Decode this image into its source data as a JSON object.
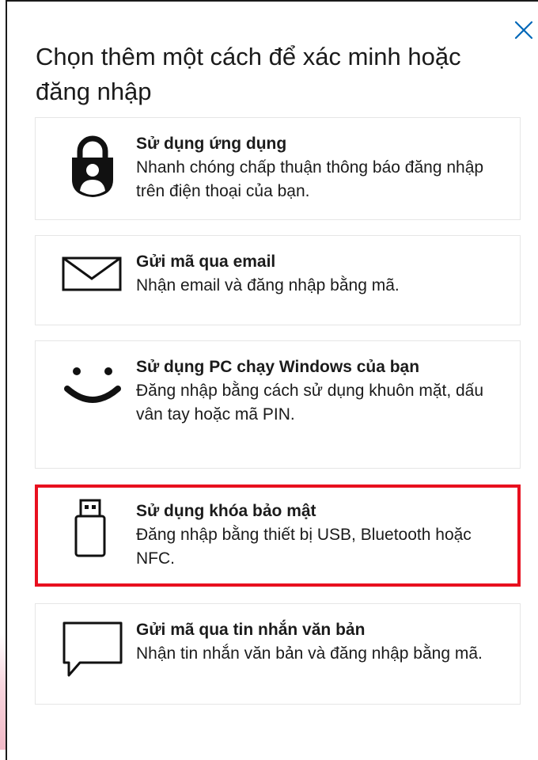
{
  "dialog": {
    "title": "Chọn thêm một cách để xác minh hoặc đăng nhập",
    "close_label": "×"
  },
  "options": [
    {
      "title": "Sử dụng ứng dụng",
      "description": "Nhanh chóng chấp thuận thông báo đăng nhập trên điện thoại của bạn.",
      "icon": "authenticator-lock-icon"
    },
    {
      "title": "Gửi mã qua email",
      "description": "Nhận email và đăng nhập bằng mã.",
      "icon": "email-envelope-icon"
    },
    {
      "title": "Sử dụng PC chạy Windows của bạn",
      "description": "Đăng nhập bằng cách sử dụng khuôn mặt, dấu vân tay hoặc mã PIN.",
      "icon": "windows-hello-face-icon"
    },
    {
      "title": "Sử dụng khóa bảo mật",
      "description": "Đăng nhập bằng thiết bị USB, Bluetooth hoặc NFC.",
      "icon": "usb-security-key-icon",
      "highlighted": true
    },
    {
      "title": "Gửi mã qua tin nhắn văn bản",
      "description": "Nhận tin nhắn văn bản và đăng nhập bằng mã.",
      "icon": "text-message-bubble-icon"
    }
  ],
  "colors": {
    "highlight_border": "#e8101f",
    "close_icon": "#0067b8",
    "text": "#1b1b1b"
  }
}
